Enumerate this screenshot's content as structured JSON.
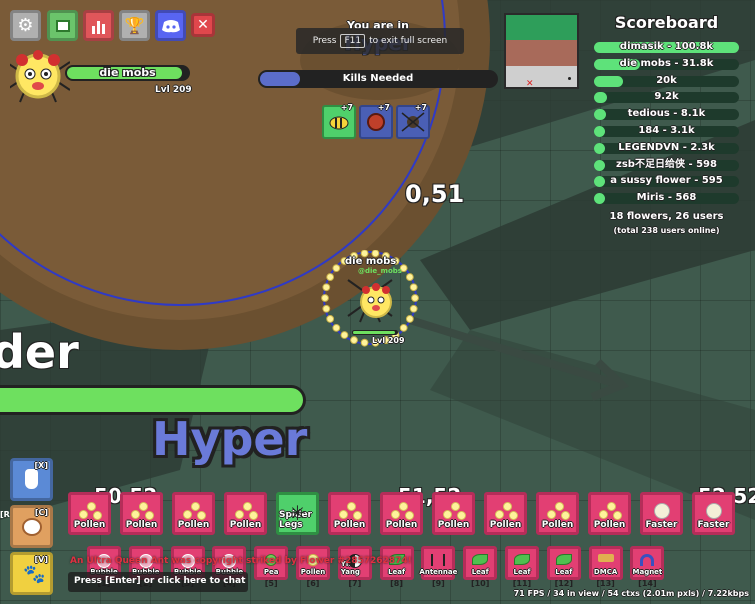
{
  "toolbar": {
    "buttons": [
      {
        "name": "settings-button",
        "icon": "gear-icon",
        "color": "#b0b0b0"
      },
      {
        "name": "inventory-button",
        "icon": "cards-icon",
        "color": "#6bc46b"
      },
      {
        "name": "stats-button",
        "icon": "bar-chart-icon",
        "color": "#e0565a"
      },
      {
        "name": "achievements-button",
        "icon": "trophy-icon",
        "color": "#b0b0b0"
      },
      {
        "name": "discord-button",
        "icon": "discord-icon",
        "color": "#5865f2"
      },
      {
        "name": "close-button",
        "icon": "close-icon",
        "color": "#e0474c"
      }
    ]
  },
  "player": {
    "name": "die mobs",
    "level": "Lvl 209",
    "health_fraction": 0.95
  },
  "zone": {
    "title": "You are in",
    "name": "Hyper",
    "kills_needed_label": "Kills Needed"
  },
  "fullscreen_notice": {
    "press": "Press",
    "key": "F11",
    "text": "to exit full screen"
  },
  "buffs": [
    {
      "icon": "bee-icon",
      "color": "#4fd06b",
      "count": "+7"
    },
    {
      "icon": "red-orb-icon",
      "color": "#4a5fb5",
      "count": "+7"
    },
    {
      "icon": "spider-icon",
      "color": "#4a5fb5",
      "count": "+7"
    }
  ],
  "scoreboard": {
    "title": "Scoreboard",
    "rows": [
      {
        "label": "dimasik - 100.8k",
        "fill": 1.0
      },
      {
        "label": "die mobs - 31.8k",
        "fill": 0.32
      },
      {
        "label": "20k",
        "fill": 0.2
      },
      {
        "label": "9.2k",
        "fill": 0.09
      },
      {
        "label": "tedious - 8.1k",
        "fill": 0.08
      },
      {
        "label": "184 - 3.1k",
        "fill": 0.03
      },
      {
        "label": "LEGENDVN - 2.3k",
        "fill": 0.02
      },
      {
        "label": "zsb不足日给侠 - 598",
        "fill": 0.01
      },
      {
        "label": "a sussy flower - 595",
        "fill": 0.01
      },
      {
        "label": "Miris - 568",
        "fill": 0.01
      }
    ],
    "summary": "18 flowers, 26 users",
    "online": "(total 238 users online)"
  },
  "world": {
    "player_label": "die mobs",
    "player_tag": "@die_mobs",
    "player_level": "Lvl 209",
    "coord_text": "0,51",
    "zone_banner_left": "der",
    "zone_banner": "Hyper",
    "ground_number_1": "50,52",
    "ground_number_2": "51,52",
    "ground_number_3": "52,52"
  },
  "hotbar": [
    {
      "label": "Pollen",
      "type": "pollen",
      "color": "#e23f73"
    },
    {
      "label": "Pollen",
      "type": "pollen",
      "color": "#e23f73"
    },
    {
      "label": "Pollen",
      "type": "pollen",
      "color": "#e23f73"
    },
    {
      "label": "Pollen",
      "type": "pollen",
      "color": "#e23f73"
    },
    {
      "label": "Spider Legs",
      "type": "spider",
      "color": "#4fd06b"
    },
    {
      "label": "Pollen",
      "type": "pollen",
      "color": "#e23f73"
    },
    {
      "label": "Pollen",
      "type": "pollen",
      "color": "#e23f73"
    },
    {
      "label": "Pollen",
      "type": "pollen",
      "color": "#e23f73"
    },
    {
      "label": "Pollen",
      "type": "pollen",
      "color": "#e23f73"
    },
    {
      "label": "Pollen",
      "type": "pollen",
      "color": "#e23f73"
    },
    {
      "label": "Pollen",
      "type": "pollen",
      "color": "#e23f73"
    },
    {
      "label": "Faster",
      "type": "faster",
      "color": "#e23f73"
    },
    {
      "label": "Faster",
      "type": "faster",
      "color": "#e23f73"
    }
  ],
  "secondary": [
    {
      "label": "Bubble",
      "key": "[1]"
    },
    {
      "label": "Bubble",
      "key": "[2]"
    },
    {
      "label": "Bubble",
      "key": "[3]"
    },
    {
      "label": "Bubble",
      "key": "[4]"
    },
    {
      "label": "Pea",
      "key": "[5]"
    },
    {
      "label": "Pollen",
      "key": "[6]"
    },
    {
      "label": "Yin Yang",
      "key": "[7]"
    },
    {
      "label": "Leaf",
      "key": "[8]"
    },
    {
      "label": "Antennae",
      "key": "[9]"
    },
    {
      "label": "Leaf",
      "key": "[10]"
    },
    {
      "label": "Leaf",
      "key": "[11]"
    },
    {
      "label": "Leaf",
      "key": "[12]"
    },
    {
      "label": "DMCA",
      "key": "[13]"
    },
    {
      "label": "Magnet",
      "key": "[14]"
    }
  ],
  "side_buttons": [
    {
      "key": "[X]",
      "icon": "bottle-icon",
      "color": "#5b8ad6"
    },
    {
      "key": "[C]",
      "icon": "bowl-icon",
      "color": "#e0a060"
    },
    {
      "key": "[V]",
      "icon": "paw-icon",
      "color": "#f0d040"
    }
  ],
  "side_hint": "[R",
  "chat": {
    "system_message": "An Ultra Queen Ant was copyright striked by Flower #2857262874!",
    "placeholder": "Press [Enter] or click here to chat"
  },
  "perf": "71 FPS / 34 in view / 54 ctxs (2.01m pxls) / 7.22kbps"
}
